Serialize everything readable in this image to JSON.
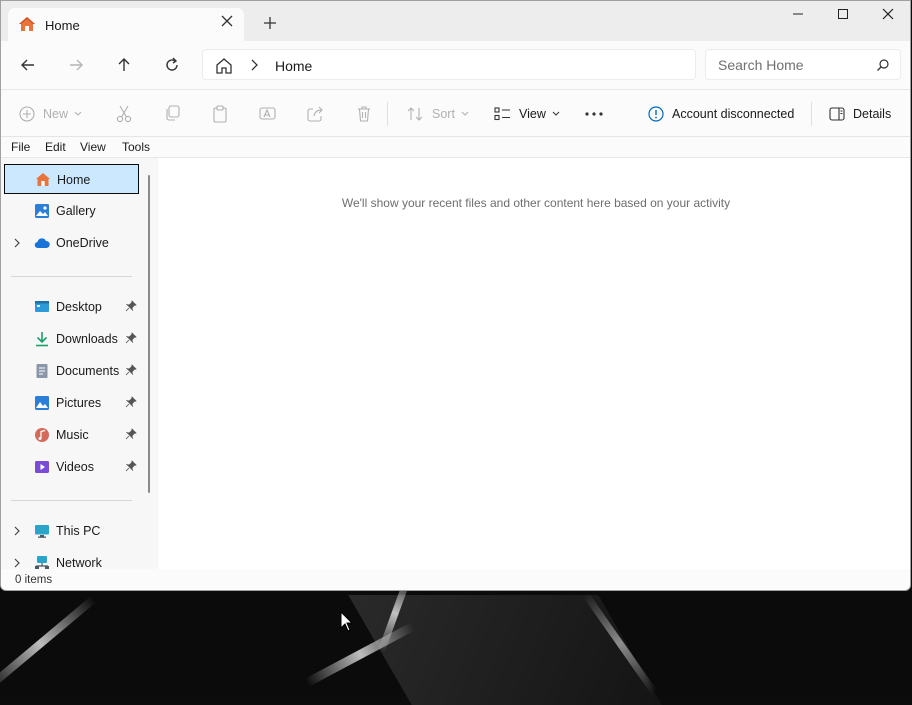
{
  "tab": {
    "title": "Home"
  },
  "address": {
    "current": "Home"
  },
  "search": {
    "placeholder": "Search Home"
  },
  "toolbar": {
    "new_label": "New",
    "sort_label": "Sort",
    "view_label": "View",
    "account_label": "Account disconnected",
    "details_label": "Details"
  },
  "menubar": {
    "items": [
      "File",
      "Edit",
      "View",
      "Tools"
    ]
  },
  "sidebar": {
    "items": [
      {
        "label": "Home",
        "icon": "home-icon"
      },
      {
        "label": "Gallery",
        "icon": "gallery-icon"
      },
      {
        "label": "OneDrive",
        "icon": "onedrive-icon"
      },
      {
        "label": "Desktop",
        "icon": "desktop-folder-icon"
      },
      {
        "label": "Downloads",
        "icon": "downloads-icon"
      },
      {
        "label": "Documents",
        "icon": "documents-icon"
      },
      {
        "label": "Pictures",
        "icon": "pictures-icon"
      },
      {
        "label": "Music",
        "icon": "music-icon"
      },
      {
        "label": "Videos",
        "icon": "videos-icon"
      },
      {
        "label": "This PC",
        "icon": "this-pc-icon"
      },
      {
        "label": "Network",
        "icon": "network-icon"
      }
    ]
  },
  "content": {
    "empty_message": "We'll show your recent files and other content here based on your activity"
  },
  "status": {
    "item_count": "0 items"
  },
  "colors": {
    "accent": "#0067c0",
    "selection": "#cce8ff",
    "home_icon": "#e8743b"
  }
}
